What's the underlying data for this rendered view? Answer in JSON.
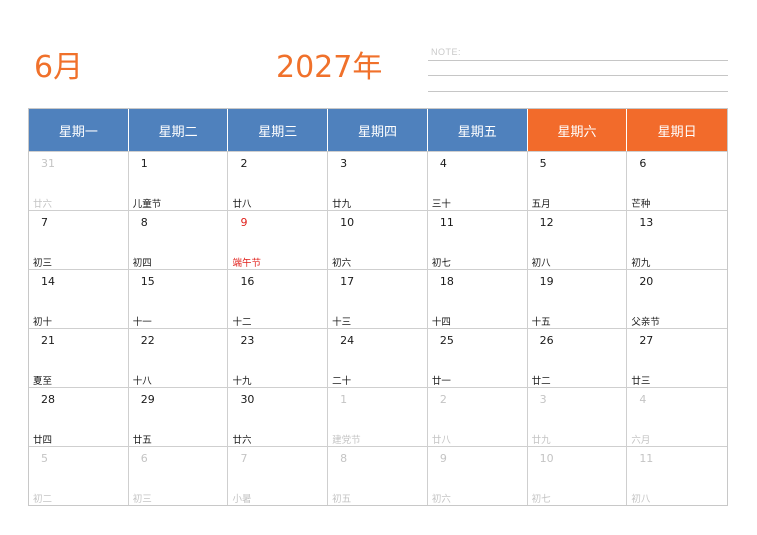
{
  "header": {
    "month": "6月",
    "year": "2027年",
    "note_label": "NOTE:"
  },
  "weekdays": [
    "星期一",
    "星期二",
    "星期三",
    "星期四",
    "星期五",
    "星期六",
    "星期日"
  ],
  "weeks": [
    [
      {
        "day": "31",
        "lunar": "廿六",
        "other": true
      },
      {
        "day": "1",
        "lunar": "儿童节"
      },
      {
        "day": "2",
        "lunar": "廿八"
      },
      {
        "day": "3",
        "lunar": "廿九"
      },
      {
        "day": "4",
        "lunar": "三十"
      },
      {
        "day": "5",
        "lunar": "五月"
      },
      {
        "day": "6",
        "lunar": "芒种"
      }
    ],
    [
      {
        "day": "7",
        "lunar": "初三"
      },
      {
        "day": "8",
        "lunar": "初四"
      },
      {
        "day": "9",
        "lunar": "端午节",
        "holiday": true
      },
      {
        "day": "10",
        "lunar": "初六"
      },
      {
        "day": "11",
        "lunar": "初七"
      },
      {
        "day": "12",
        "lunar": "初八"
      },
      {
        "day": "13",
        "lunar": "初九"
      }
    ],
    [
      {
        "day": "14",
        "lunar": "初十"
      },
      {
        "day": "15",
        "lunar": "十一"
      },
      {
        "day": "16",
        "lunar": "十二"
      },
      {
        "day": "17",
        "lunar": "十三"
      },
      {
        "day": "18",
        "lunar": "十四"
      },
      {
        "day": "19",
        "lunar": "十五"
      },
      {
        "day": "20",
        "lunar": "父亲节"
      }
    ],
    [
      {
        "day": "21",
        "lunar": "夏至"
      },
      {
        "day": "22",
        "lunar": "十八"
      },
      {
        "day": "23",
        "lunar": "十九"
      },
      {
        "day": "24",
        "lunar": "二十"
      },
      {
        "day": "25",
        "lunar": "廿一"
      },
      {
        "day": "26",
        "lunar": "廿二"
      },
      {
        "day": "27",
        "lunar": "廿三"
      }
    ],
    [
      {
        "day": "28",
        "lunar": "廿四"
      },
      {
        "day": "29",
        "lunar": "廿五"
      },
      {
        "day": "30",
        "lunar": "廿六"
      },
      {
        "day": "1",
        "lunar": "建党节",
        "other": true
      },
      {
        "day": "2",
        "lunar": "廿八",
        "other": true
      },
      {
        "day": "3",
        "lunar": "廿九",
        "other": true
      },
      {
        "day": "4",
        "lunar": "六月",
        "other": true
      }
    ],
    [
      {
        "day": "5",
        "lunar": "初二",
        "other": true
      },
      {
        "day": "6",
        "lunar": "初三",
        "other": true
      },
      {
        "day": "7",
        "lunar": "小暑",
        "other": true
      },
      {
        "day": "8",
        "lunar": "初五",
        "other": true
      },
      {
        "day": "9",
        "lunar": "初六",
        "other": true
      },
      {
        "day": "10",
        "lunar": "初七",
        "other": true
      },
      {
        "day": "11",
        "lunar": "初八",
        "other": true
      }
    ]
  ],
  "colors": {
    "accent": "#f0712b",
    "weekday_header": "#4f81bd",
    "weekend_header": "#f26b2b",
    "holiday": "#e0201b",
    "other_month": "#c4c4c4"
  }
}
